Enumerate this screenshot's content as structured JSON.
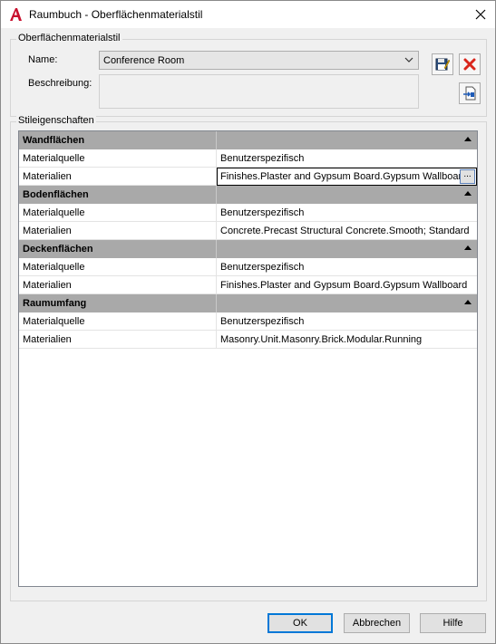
{
  "window": {
    "title": "Raumbuch - Oberflächenmaterialstil"
  },
  "style_group": {
    "legend": "Oberflächenmaterialstil",
    "name_label": "Name:",
    "name_value": "Conference Room",
    "description_label": "Beschreibung:",
    "description_value": ""
  },
  "properties_group": {
    "legend": "Stileigenschaften",
    "sections": [
      {
        "title": "Wandflächen",
        "rows": [
          {
            "label": "Materialquelle",
            "value": "Benutzerspezifisch"
          },
          {
            "label": "Materialien",
            "value": "Finishes.Plaster and Gypsum Board.Gypsum Wallboard"
          }
        ]
      },
      {
        "title": "Bodenflächen",
        "rows": [
          {
            "label": "Materialquelle",
            "value": "Benutzerspezifisch"
          },
          {
            "label": "Materialien",
            "value": "Concrete.Precast Structural Concrete.Smooth; Standard"
          }
        ]
      },
      {
        "title": "Deckenflächen",
        "rows": [
          {
            "label": "Materialquelle",
            "value": "Benutzerspezifisch"
          },
          {
            "label": "Materialien",
            "value": "Finishes.Plaster and Gypsum Board.Gypsum Wallboard"
          }
        ]
      },
      {
        "title": "Raumumfang",
        "rows": [
          {
            "label": "Materialquelle",
            "value": "Benutzerspezifisch"
          },
          {
            "label": "Materialien",
            "value": "Masonry.Unit.Masonry.Brick.Modular.Running"
          }
        ]
      }
    ],
    "ellipsis_label": "..."
  },
  "buttons": {
    "ok": "OK",
    "cancel": "Abbrechen",
    "help": "Hilfe"
  },
  "icons": {
    "app": "autocad-a-icon",
    "close": "close-x-icon",
    "save": "floppy-edit-icon",
    "delete": "red-x-delete-icon",
    "import": "import-document-icon",
    "dropdown": "chevron-down-icon"
  },
  "colors": {
    "delete_red": "#d9261c",
    "accent_blue": "#0078d7",
    "app_red": "#c8102e",
    "header_gray": "#a9a9a9"
  }
}
